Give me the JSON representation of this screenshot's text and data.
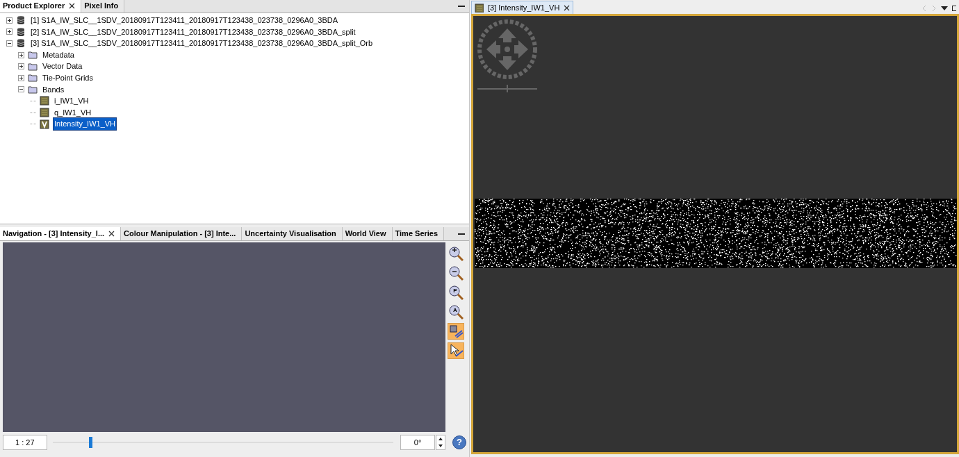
{
  "explorer_tabs": [
    {
      "label": "Product Explorer",
      "selected": true,
      "closable": true
    },
    {
      "label": "Pixel Info",
      "selected": false,
      "closable": false
    }
  ],
  "tree": [
    {
      "kind": "product",
      "label": "[1] S1A_IW_SLC__1SDV_20180917T123411_20180917T123438_023738_0296A0_3BDA",
      "expanded": false,
      "selected": false
    },
    {
      "kind": "product",
      "label": "[2] S1A_IW_SLC__1SDV_20180917T123411_20180917T123438_023738_0296A0_3BDA_split",
      "expanded": false,
      "selected": false
    },
    {
      "kind": "product",
      "label": "[3] S1A_IW_SLC__1SDV_20180917T123411_20180917T123438_023738_0296A0_3BDA_split_Orb",
      "expanded": true,
      "selected": false,
      "children": [
        {
          "kind": "folder",
          "label": "Metadata",
          "expanded": false,
          "selected": false
        },
        {
          "kind": "folder",
          "label": "Vector Data",
          "expanded": false,
          "selected": false
        },
        {
          "kind": "folder",
          "label": "Tie-Point Grids",
          "expanded": false,
          "selected": false
        },
        {
          "kind": "folder",
          "label": "Bands",
          "expanded": true,
          "selected": false,
          "children": [
            {
              "kind": "band",
              "label": "i_IW1_VH",
              "selected": false
            },
            {
              "kind": "band",
              "label": "q_IW1_VH",
              "selected": false
            },
            {
              "kind": "virtual_band",
              "label": "Intensity_IW1_VH",
              "selected": true
            }
          ]
        }
      ]
    }
  ],
  "tool_tabs": [
    {
      "label": "Navigation - [3] Intensity_I...",
      "selected": true,
      "closable": true
    },
    {
      "label": "Colour Manipulation - [3] Inte...",
      "selected": false,
      "closable": false
    },
    {
      "label": "Uncertainty Visualisation",
      "selected": false,
      "closable": false
    },
    {
      "label": "World View",
      "selected": false,
      "closable": false
    },
    {
      "label": "Time Series",
      "selected": false,
      "closable": false
    }
  ],
  "nav_tools": [
    {
      "kind": "zoom_in",
      "on": false
    },
    {
      "kind": "zoom_out",
      "on": false
    },
    {
      "kind": "zoom_pixel",
      "glyph": "P",
      "on": false
    },
    {
      "kind": "zoom_all",
      "glyph": "A",
      "on": false
    },
    {
      "kind": "sync_views",
      "on": true
    },
    {
      "kind": "sync_cursor",
      "on": true
    }
  ],
  "help_glyph": "?",
  "scale": "1 : 27",
  "zoom_slider": {
    "level": 0.11
  },
  "rotation": "0°",
  "image_tab": {
    "label": "[3] Intensity_IW1_VH",
    "selected": true
  }
}
